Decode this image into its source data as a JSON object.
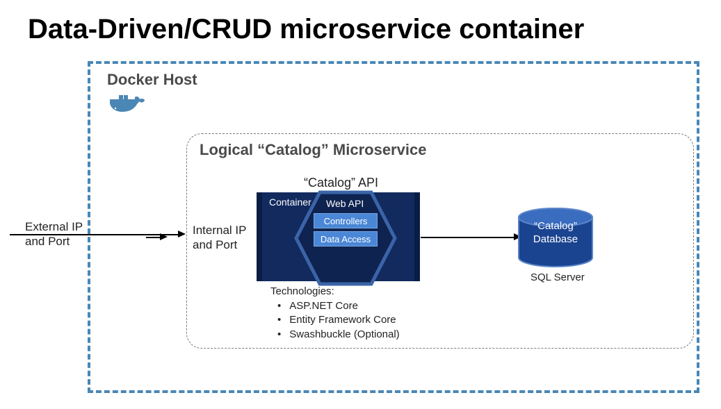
{
  "title": "Data-Driven/CRUD microservice container",
  "docker_host": {
    "label": "Docker Host"
  },
  "logical_ms": {
    "label": "Logical “Catalog” Microservice",
    "api_label": "“Catalog” API",
    "container_label": "Container",
    "webapi_label": "Web API",
    "controllers_label": "Controllers",
    "dataaccess_label": "Data Access",
    "tech_header": "Technologies:",
    "tech_items": [
      "ASP.NET Core",
      "Entity Framework Core",
      "Swashbuckle (Optional)"
    ]
  },
  "database": {
    "line1": "“Catalog”",
    "line2": "Database",
    "engine": "SQL Server"
  },
  "arrows": {
    "external": "External IP\nand Port",
    "internal": "Internal IP\nand Port"
  }
}
